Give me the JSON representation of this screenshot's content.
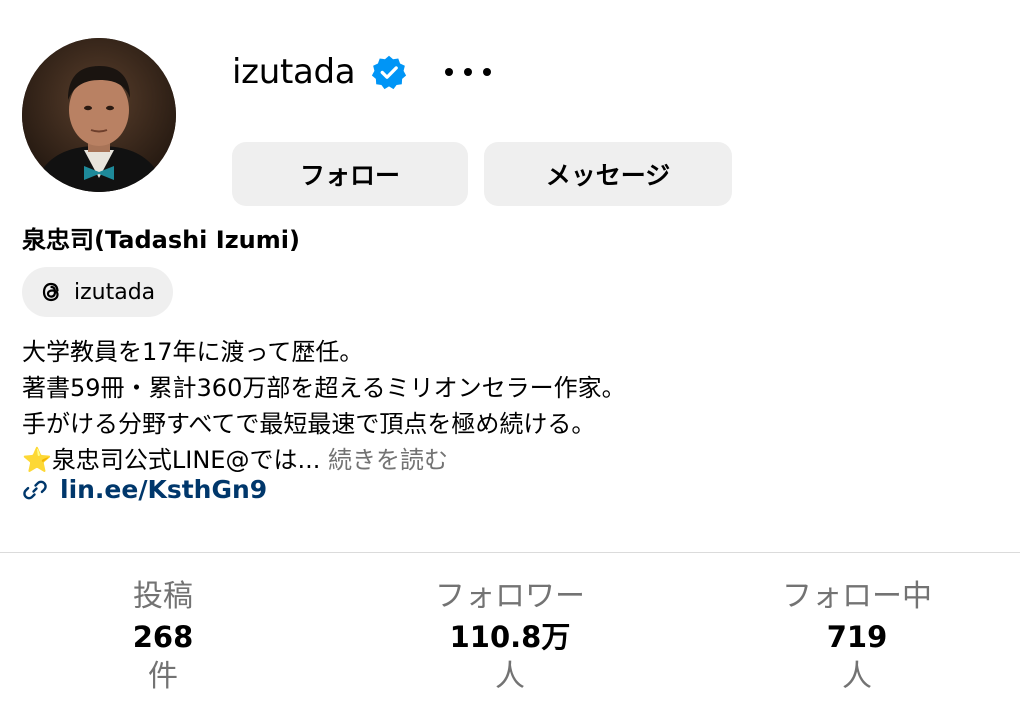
{
  "profile": {
    "username": "izutada",
    "display_name": "泉忠司(Tadashi Izumi)",
    "verified_icon": "verified-badge-icon",
    "more_icon": "more-options-icon",
    "threads": {
      "icon": "threads-icon",
      "handle": "izutada"
    },
    "bio_lines": [
      "大学教員を17年に渡って歴任。",
      "著書59冊・累計360万部を超えるミリオンセラー作家。",
      "手がける分野すべてで最短最速で頂点を極め続ける。"
    ],
    "bio_last_line": {
      "emoji": "⭐️",
      "text": "泉忠司公式LINE@では...",
      "more_label": "続きを読む"
    },
    "link": {
      "icon": "link-icon",
      "text": "lin.ee/KsthGn9"
    }
  },
  "buttons": {
    "follow": "フォロー",
    "message": "メッセージ"
  },
  "stats": {
    "posts": {
      "label": "投稿",
      "value": "268",
      "unit": "件"
    },
    "followers": {
      "label": "フォロワー",
      "value": "110.8万",
      "unit": "人"
    },
    "following": {
      "label": "フォロー中",
      "value": "719",
      "unit": "人"
    }
  },
  "colors": {
    "button_bg": "#efefef",
    "verified_blue": "#0095f6",
    "link_color": "#00376b",
    "muted_text": "#737373",
    "divider": "#dbdbdb"
  }
}
